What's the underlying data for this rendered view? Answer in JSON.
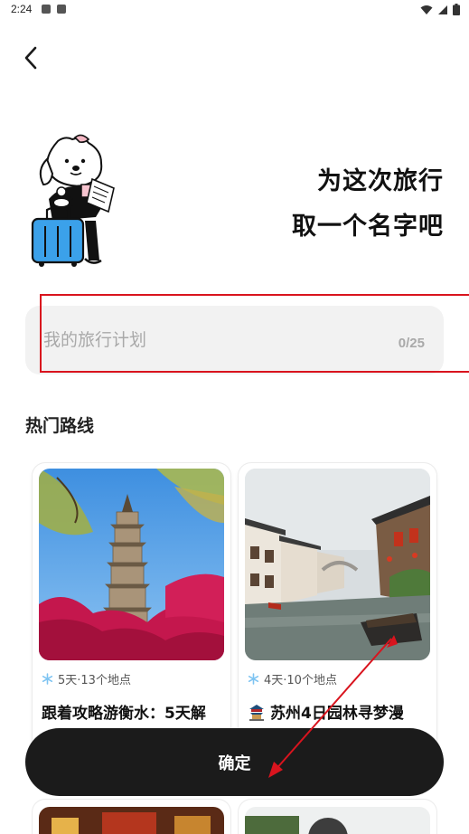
{
  "status_bar": {
    "time": "2:24"
  },
  "header": {
    "back_icon": "chevron-left-icon"
  },
  "headline": {
    "line1": "为这次旅行",
    "line2": "取一个名字吧"
  },
  "trip_name": {
    "placeholder": "我的旅行计划",
    "value": "",
    "counter": "0/25"
  },
  "popular": {
    "title": "热门路线",
    "cards": [
      {
        "meta": "5天·13个地点",
        "title": "跟着攻略游衡水：5天解",
        "image": "pagoda-photo"
      },
      {
        "meta": "4天·10个地点",
        "title": "苏州4日园林寻梦漫",
        "title_icon": "pavilion-icon",
        "image": "canal-town-photo"
      }
    ]
  },
  "confirm": {
    "label": "确定"
  },
  "colors": {
    "annotation_red": "#d9141e",
    "button_dark": "#1b1b1b",
    "input_bg": "#f2f2f2"
  }
}
